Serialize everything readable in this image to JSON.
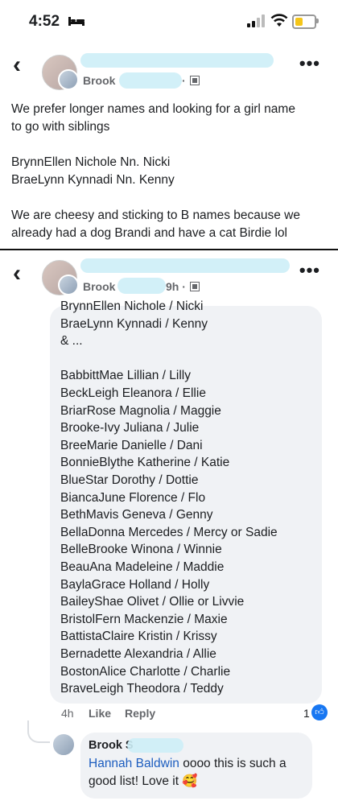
{
  "status_bar": {
    "time": "4:52"
  },
  "post": {
    "author_partial": "Brook",
    "time_dot": "·",
    "body_lines": [
      "We prefer longer names and looking for a girl name",
      "to go with siblings",
      "",
      "BrynnEllen Nichole Nn. Nicki",
      "BraeLynn Kynnadi Nn. Kenny",
      "",
      "We are cheesy and sticking to B names because we",
      "already had a dog Brandi and have a cat Birdie lol"
    ]
  },
  "comment": {
    "author_partial": "Brook",
    "time_suffix": "9h ·",
    "lines": [
      "BrynnEllen Nichole / Nicki",
      "BraeLynn Kynnadi / Kenny",
      "& ...",
      "",
      "BabbittMae Lillian / Lilly",
      "BeckLeigh Eleanora / Ellie",
      "BriarRose Magnolia / Maggie",
      "Brooke-Ivy Juliana / Julie",
      "BreeMarie Danielle / Dani",
      "BonnieBlythe Katherine / Katie",
      "BlueStar Dorothy / Dottie",
      "BiancaJune Florence / Flo",
      "BethMavis Geneva / Genny",
      "BellaDonna Mercedes / Mercy or Sadie",
      "BelleBrooke Winona / Winnie",
      "BeauAna Madeleine / Maddie",
      "BaylaGrace Holland / Holly",
      "BaileyShae Olivet / Ollie or Livvie",
      "BristolFern Mackenzie / Maxie",
      "BattistaClaire Kristin / Krissy",
      "Bernadette Alexandria / Allie",
      "BostonAlice Charlotte / Charlie",
      "BraveLeigh Theodora / Teddy"
    ],
    "age": "4h",
    "like_label": "Like",
    "reply_label": "Reply",
    "reaction_count": "1"
  },
  "reply": {
    "author_partial": "Brook S",
    "mention": "Hannah Baldwin",
    "text_line1": " oooo this is such a",
    "text_line2": "good list! Love it 🥰"
  },
  "colors": {
    "accent": "#1877f2",
    "bubble": "#f0f2f5",
    "redaction": "#cdeef7"
  }
}
